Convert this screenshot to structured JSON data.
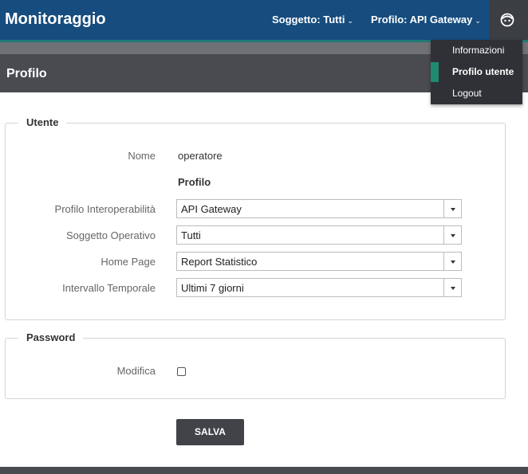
{
  "header": {
    "app_title": "Monitoraggio",
    "soggetto_label": "Soggetto: Tutti",
    "profilo_label": "Profilo: API Gateway",
    "user_icon": "user-face-icon",
    "chevron_icon": "chevron-down-icon"
  },
  "user_menu": {
    "items": [
      {
        "label": "Informazioni",
        "active": false
      },
      {
        "label": "Profilo utente",
        "active": true
      },
      {
        "label": "Logout",
        "active": false
      }
    ]
  },
  "page": {
    "title": "Profilo"
  },
  "utente": {
    "legend": "Utente",
    "nome_label": "Nome",
    "nome_value": "operatore",
    "profilo_heading": "Profilo",
    "fields": [
      {
        "label": "Profilo Interoperabilità",
        "value": "API Gateway"
      },
      {
        "label": "Soggetto Operativo",
        "value": "Tutti"
      },
      {
        "label": "Home Page",
        "value": "Report Statistico"
      },
      {
        "label": "Intervallo Temporale",
        "value": "Ultimi 7 giorni"
      }
    ]
  },
  "password": {
    "legend": "Password",
    "modifica_label": "Modifica",
    "modifica_checked": false
  },
  "actions": {
    "save_label": "SALVA"
  },
  "colors": {
    "header_bg": "#164c7e",
    "accent": "#1f8a70",
    "dark_bar": "#494b51",
    "button_bg": "#414348"
  }
}
